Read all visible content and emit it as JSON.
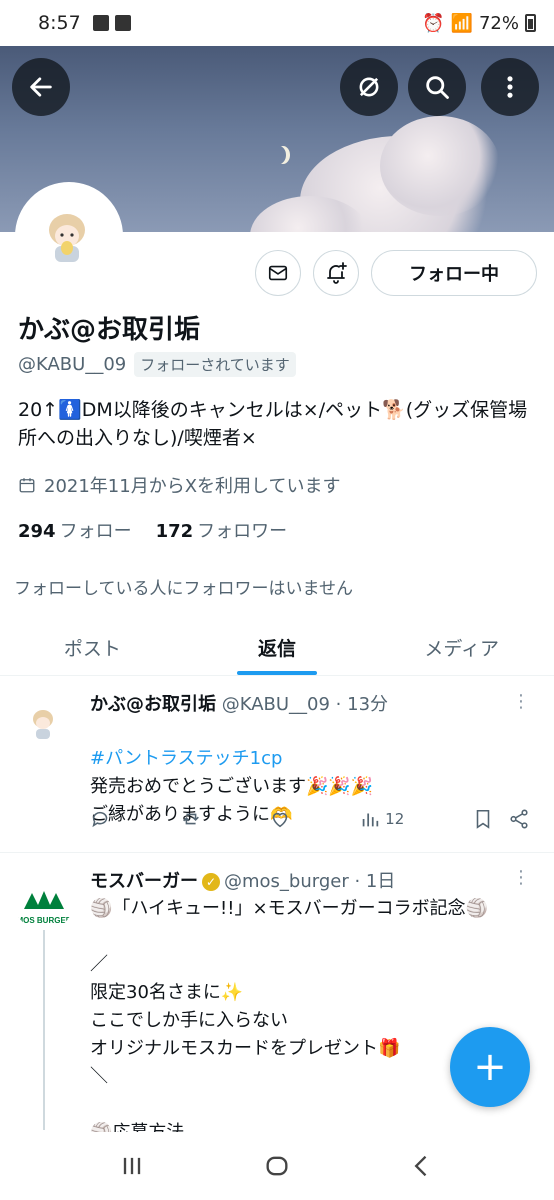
{
  "status_bar": {
    "time": "8:57",
    "battery": "72%"
  },
  "profile": {
    "name": "かぶ@お取引垢",
    "handle": "@KABU__09",
    "follows_you": "フォローされています",
    "bio": "20↑🚺DM以降後のキャンセルは×/ペット🐕(グッズ保管場所への出入りなし)/喫煙者×",
    "joined": "2021年11月からXを利用しています",
    "following_count": "294",
    "following_label": "フォロー",
    "followers_count": "172",
    "followers_label": "フォロワー",
    "no_mutuals": "フォローしている人にフォロワーはいません",
    "follow_button": "フォロー中"
  },
  "tabs": [
    {
      "label": "ポスト",
      "active": false
    },
    {
      "label": "返信",
      "active": true
    },
    {
      "label": "メディア",
      "active": false
    }
  ],
  "tweets": [
    {
      "name": "かぶ@お取引垢",
      "meta": "@KABU__09 · 13分",
      "hashtag": "#パントラステッチ1cp",
      "text": "発売おめでとうございます🎉🎉🎉\nご縁がありますように🫶",
      "views": "12"
    },
    {
      "name": "モスバーガー",
      "meta": "@mos_burger · 1日",
      "avatar_label": "MOS BURGER",
      "text": "🏐「ハイキュー!!」×モスバーガーコラボ記念🏐\n\n／\n限定30名さまに✨\nここでしか手に入らない\nオリジナルモスカードをプレゼント🎁\n＼\n\n🏐応募方法"
    }
  ],
  "fab_label": "+",
  "colors": {
    "accent": "#1d9bf0",
    "text": "#0f1419",
    "secondary": "#536471",
    "mos_green": "#00803c"
  }
}
